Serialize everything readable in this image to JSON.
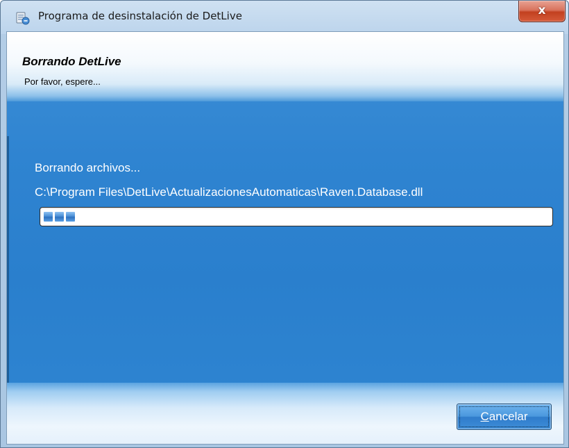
{
  "window": {
    "title": "Programa de desinstalación de DetLive",
    "close_label": "x",
    "app_icon": "uninstaller-icon",
    "close_icon": "close-icon"
  },
  "header": {
    "title": "Borrando DetLive",
    "subtitle": "Por favor, espere..."
  },
  "body": {
    "status": "Borrando archivos...",
    "current_file": "C:\\Program Files\\DetLive\\ActualizacionesAutomaticas\\Raven.Database.dll",
    "progress_fraction": 0.07
  },
  "footer": {
    "cancel_mnemonic": "C",
    "cancel_rest": "ancelar"
  },
  "colors": {
    "client_blue": "#2f84d1",
    "close_red": "#c2401f",
    "progress_blue": "#2f72c0"
  }
}
